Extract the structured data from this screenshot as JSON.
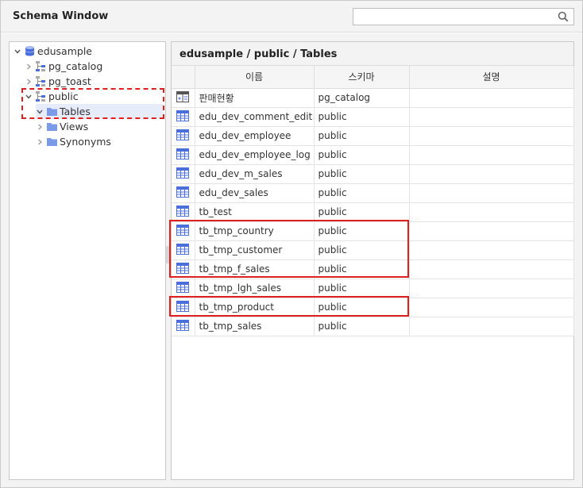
{
  "window": {
    "title": "Schema Window"
  },
  "search": {
    "placeholder": "",
    "value": ""
  },
  "tree": {
    "root": "edusample",
    "schemas": [
      "pg_catalog",
      "pg_toast",
      "public"
    ],
    "folders": [
      "Tables",
      "Views",
      "Synonyms"
    ]
  },
  "main": {
    "breadcrumb": "edusample / public / Tables",
    "columns": [
      "이름",
      "스키마",
      "설명"
    ],
    "rows": [
      {
        "icon": "view-table-icon",
        "name": "판매현황",
        "schema": "pg_catalog",
        "desc": ""
      },
      {
        "icon": "table-icon",
        "name": "edu_dev_comment_edit",
        "schema": "public",
        "desc": ""
      },
      {
        "icon": "table-icon",
        "name": "edu_dev_employee",
        "schema": "public",
        "desc": ""
      },
      {
        "icon": "table-icon",
        "name": "edu_dev_employee_log",
        "schema": "public",
        "desc": ""
      },
      {
        "icon": "table-icon",
        "name": "edu_dev_m_sales",
        "schema": "public",
        "desc": ""
      },
      {
        "icon": "table-icon",
        "name": "edu_dev_sales",
        "schema": "public",
        "desc": ""
      },
      {
        "icon": "table-icon",
        "name": "tb_test",
        "schema": "public",
        "desc": ""
      },
      {
        "icon": "table-icon",
        "name": "tb_tmp_country",
        "schema": "public",
        "desc": ""
      },
      {
        "icon": "table-icon",
        "name": "tb_tmp_customer",
        "schema": "public",
        "desc": ""
      },
      {
        "icon": "table-icon",
        "name": "tb_tmp_f_sales",
        "schema": "public",
        "desc": ""
      },
      {
        "icon": "table-icon",
        "name": "tb_tmp_lgh_sales",
        "schema": "public",
        "desc": ""
      },
      {
        "icon": "table-icon",
        "name": "tb_tmp_product",
        "schema": "public",
        "desc": ""
      },
      {
        "icon": "table-icon",
        "name": "tb_tmp_sales",
        "schema": "public",
        "desc": ""
      }
    ]
  },
  "colors": {
    "accent": "#4a6fdc",
    "folder": "#7b9ae8",
    "highlight": "#e02020",
    "selected": "#e6ecfa"
  }
}
